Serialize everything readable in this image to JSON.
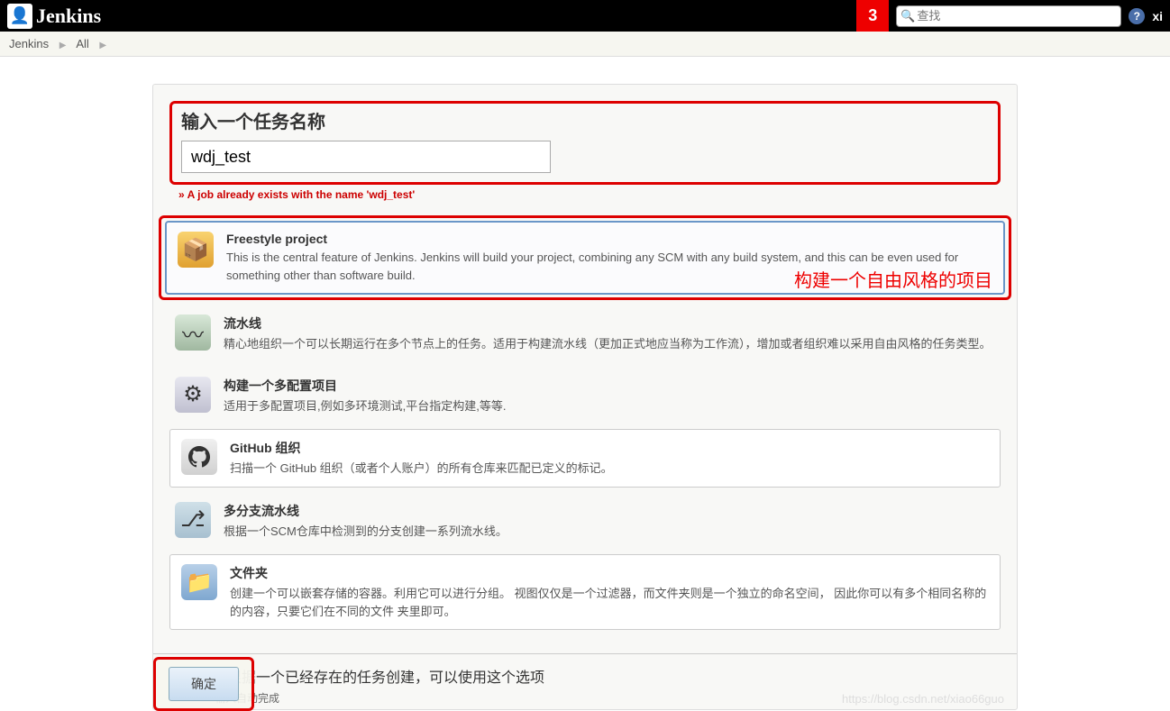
{
  "header": {
    "logo_text": "Jenkins",
    "badge": "3",
    "search_placeholder": "查找",
    "x": "xi"
  },
  "breadcrumb": {
    "item0": "Jenkins",
    "item1": "All"
  },
  "nameSection": {
    "label": "输入一个任务名称",
    "value": "wdj_test",
    "error": "» A job already exists with the name 'wdj_test'"
  },
  "items": {
    "freestyle": {
      "title": "Freestyle project",
      "desc": "This is the central feature of Jenkins. Jenkins will build your project, combining any SCM with any build system, and this can be even used for something other than software build.",
      "annotation": "构建一个自由风格的项目"
    },
    "pipeline": {
      "title": "流水线",
      "desc": "精心地组织一个可以长期运行在多个节点上的任务。适用于构建流水线（更加正式地应当称为工作流），增加或者组织难以采用自由风格的任务类型。"
    },
    "multiconfig": {
      "title": "构建一个多配置项目",
      "desc": "适用于多配置项目,例如多环境测试,平台指定构建,等等."
    },
    "github": {
      "title": "GitHub 组织",
      "desc": "扫描一个 GitHub 组织（或者个人账户）的所有仓库来匹配已定义的标记。"
    },
    "multibranch": {
      "title": "多分支流水线",
      "desc": "根据一个SCM仓库中检测到的分支创建一系列流水线。"
    },
    "folder": {
      "title": "文件夹",
      "desc": "创建一个可以嵌套存储的容器。利用它可以进行分组。 视图仅仅是一个过滤器，而文件夹则是一个独立的命名空间， 因此你可以有多个相同名称的的内容，只要它们在不同的文件 夹里即可。"
    }
  },
  "footer": {
    "title_grey": "如果你想根据",
    "title_dark": "一个已经存在的任务创建，可以使用这个选项",
    "ok": "确定",
    "autohint": "输入自动完成"
  },
  "watermark": "https://blog.csdn.net/xiao66guo"
}
